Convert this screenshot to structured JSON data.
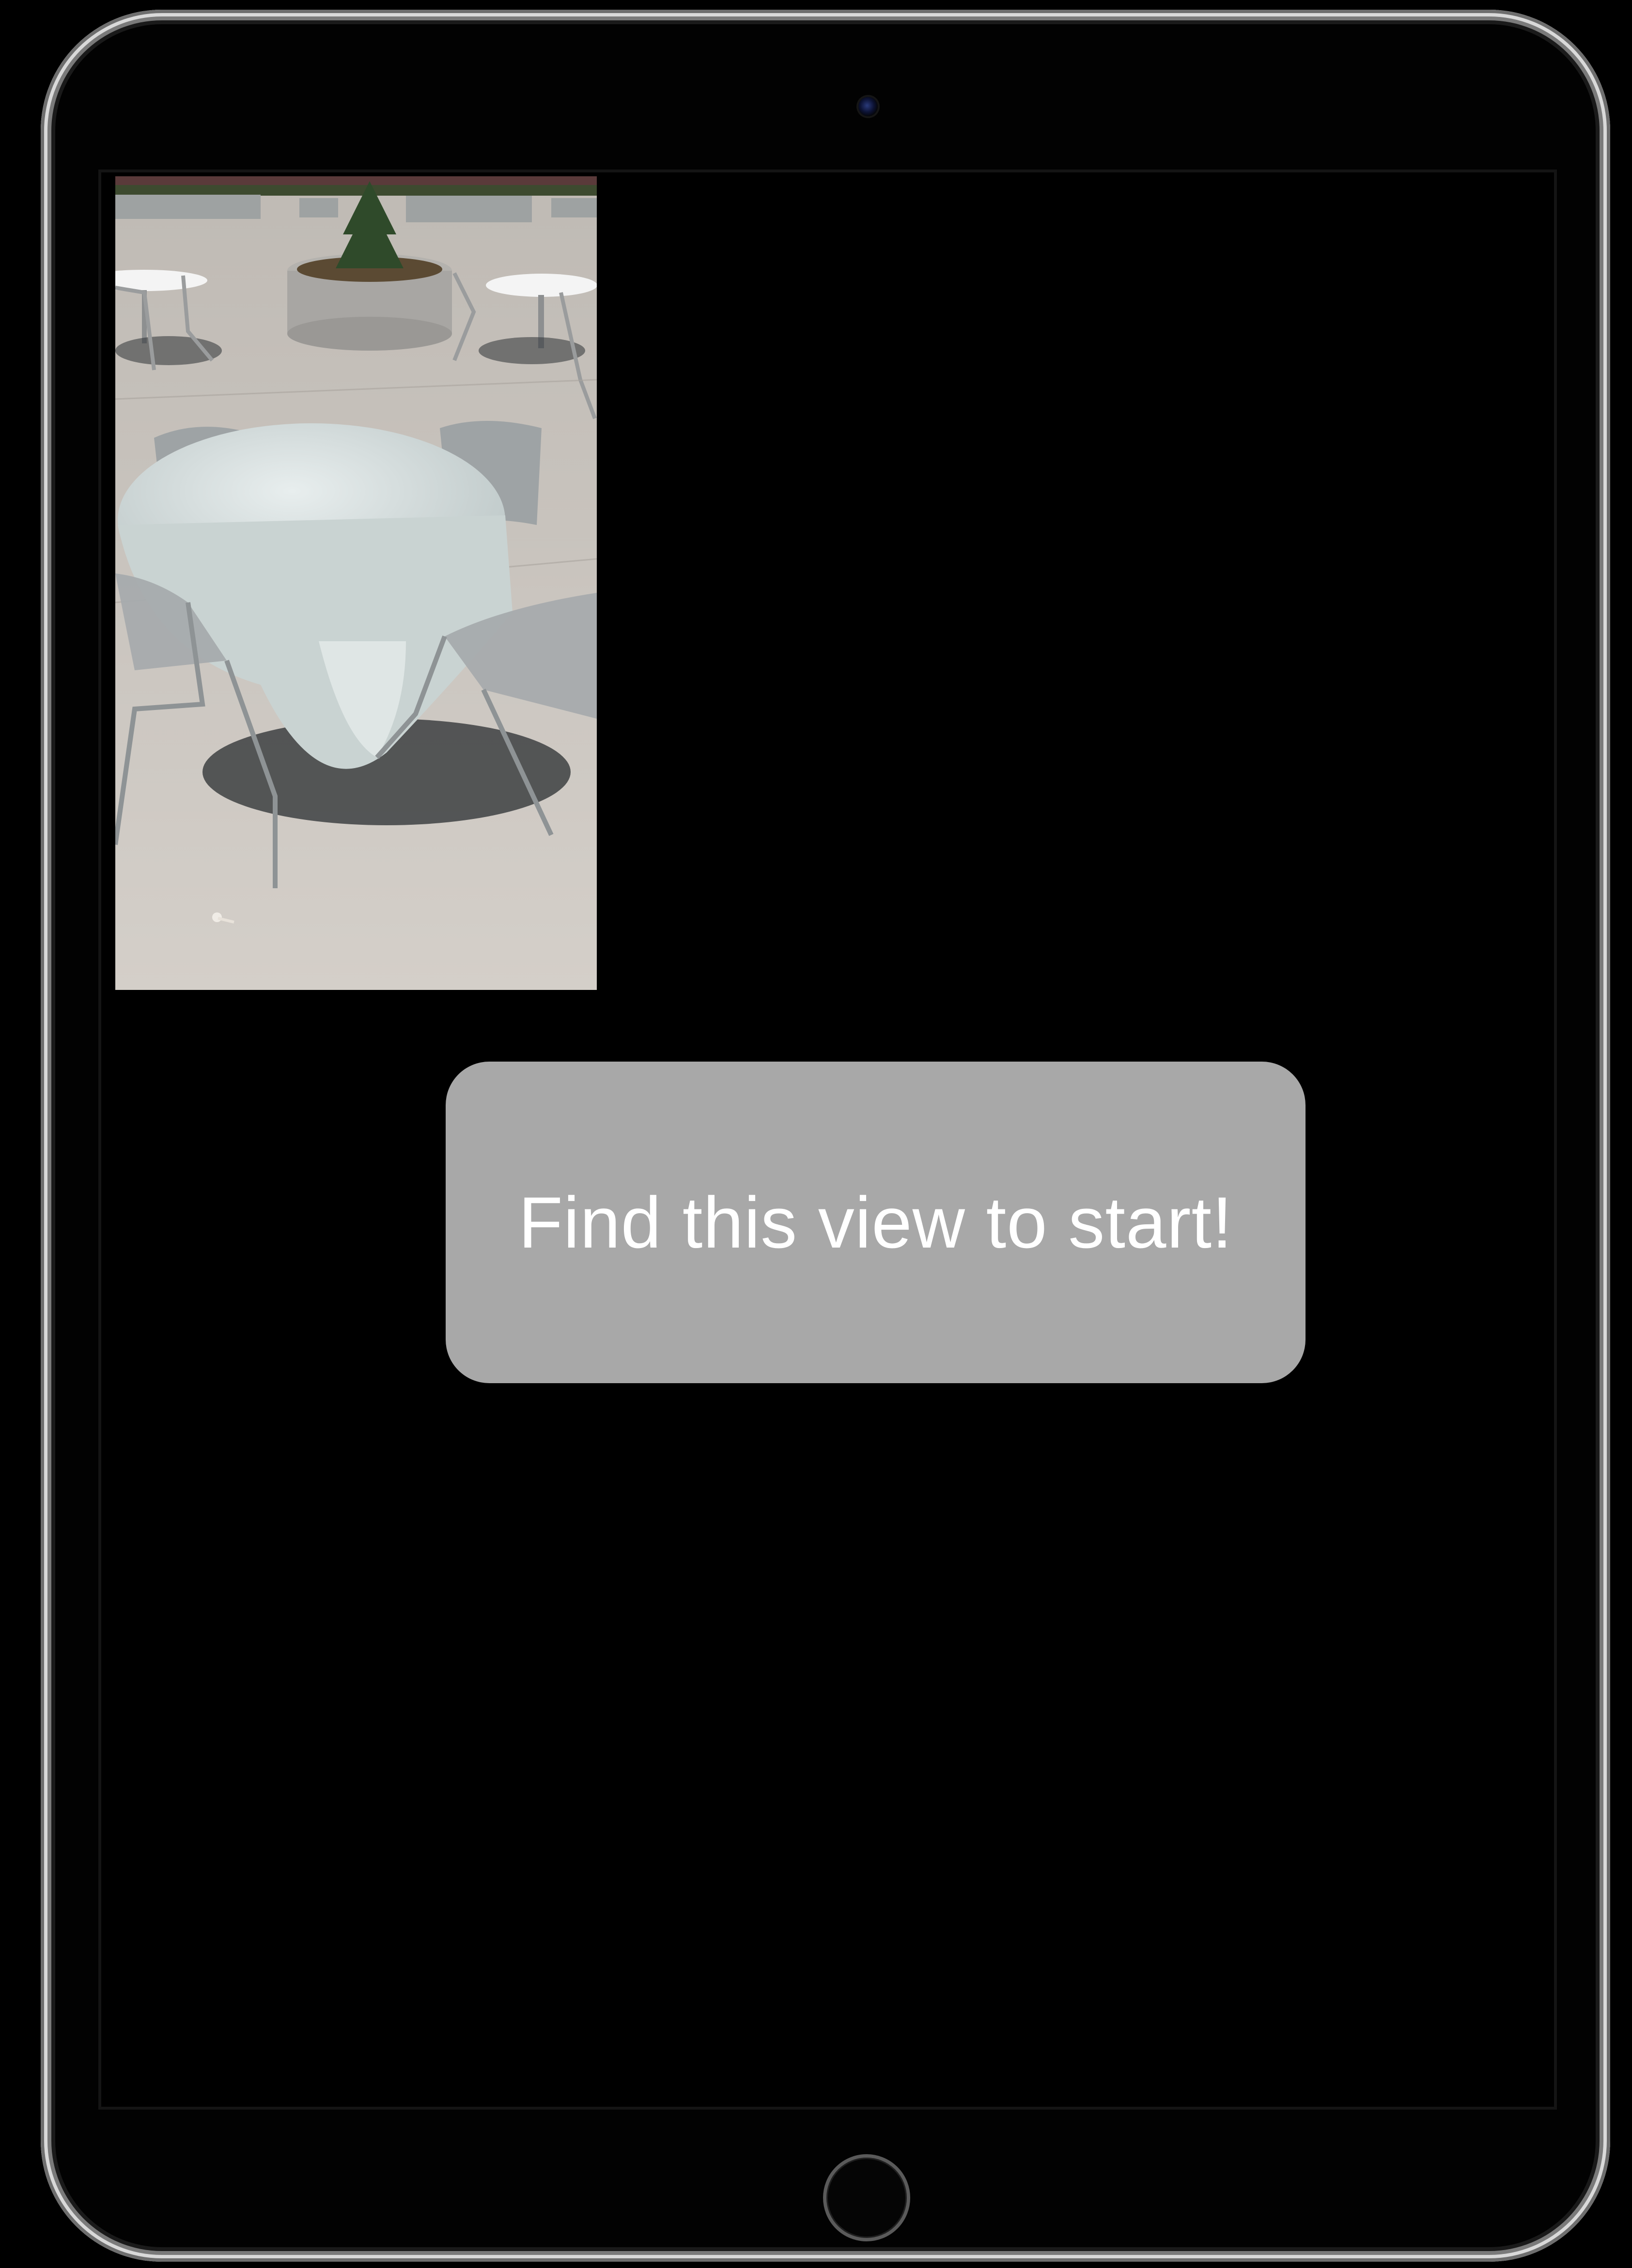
{
  "device": {
    "model": "iPad",
    "bezel_color": "#020202",
    "frame_color": "#d9d9d9",
    "camera_icon": "front-camera-icon",
    "home_icon": "home-button-icon"
  },
  "screen": {
    "background": "#000000"
  },
  "reference_image": {
    "subject": "outdoor patio table with tablecloth and mesh chairs"
  },
  "prompt": {
    "text": "Find this view to start!",
    "background": "#a8a8a8",
    "text_color": "#ffffff"
  }
}
